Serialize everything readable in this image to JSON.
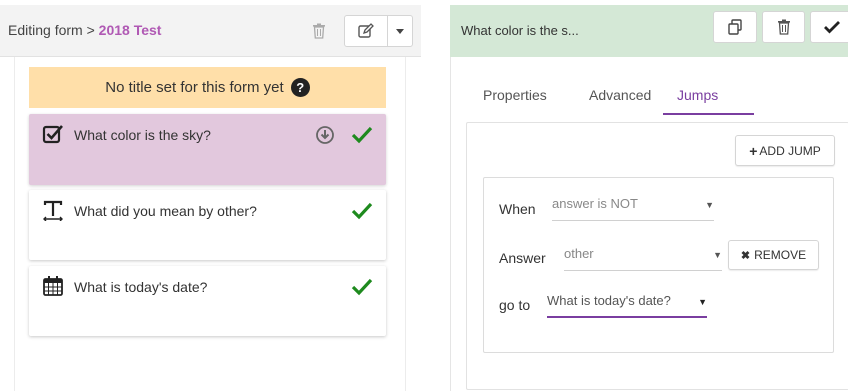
{
  "left": {
    "breadcrumb_prefix": "Editing form > ",
    "form_name": "2018 Test",
    "no_title_message": "No title set for this form yet",
    "help_glyph": "?",
    "questions": [
      {
        "text": "What color is the sky?",
        "icon": "checkbox-icon",
        "active": true
      },
      {
        "text": "What did you mean by other?",
        "icon": "text-icon",
        "active": false
      },
      {
        "text": "What is today's date?",
        "icon": "calendar-icon",
        "active": false
      }
    ]
  },
  "right": {
    "title": "What color is the s...",
    "tabs": [
      "Properties",
      "Advanced",
      "Jumps"
    ],
    "active_tab": "Jumps",
    "add_jump_label": "ADD JUMP",
    "add_jump_glyph": "+",
    "when_label": "When",
    "when_value": "answer is NOT",
    "answer_label": "Answer",
    "answer_value": "other",
    "remove_label": "REMOVE",
    "remove_glyph": "✖",
    "goto_label": "go to",
    "goto_value": "What is today's date?"
  },
  "colors": {
    "accent": "#7a3ea0",
    "form_name": "#b059b4",
    "active_card": "#e2c8dd",
    "header_green": "#d4e8d6",
    "banner": "#ffdfa9",
    "check_green": "#1e8a1e"
  }
}
